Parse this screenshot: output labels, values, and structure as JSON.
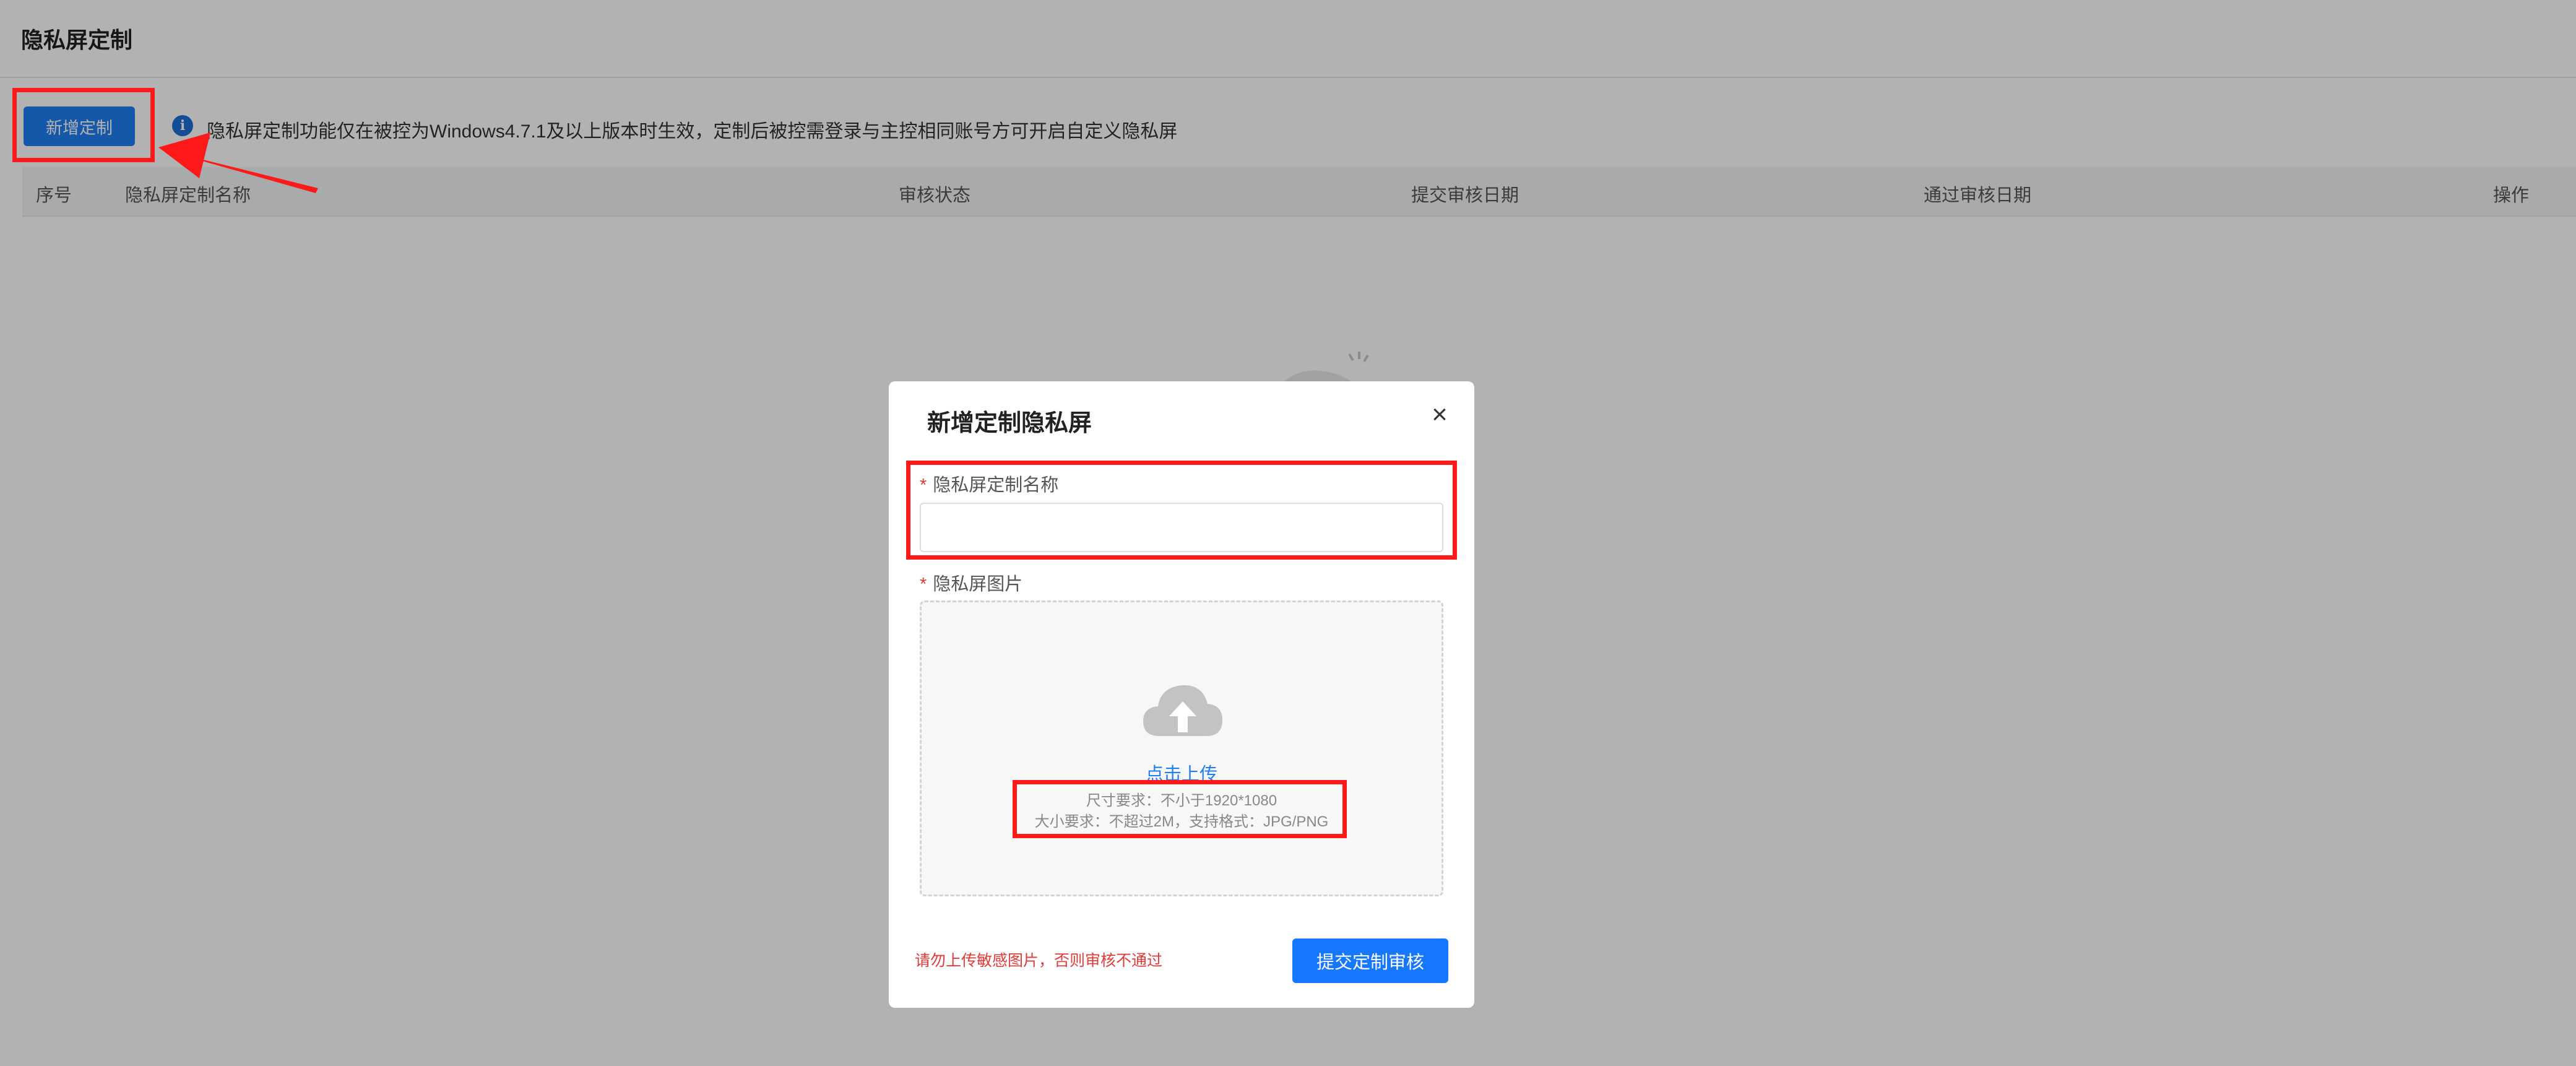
{
  "page": {
    "title": "隐私屏定制",
    "add_button": "新增定制",
    "info_text": "隐私屏定制功能仅在被控为Windows4.7.1及以上版本时生效，定制后被控需登录与主控相同账号方可开启自定义隐私屏",
    "info_icon": "info-icon"
  },
  "table": {
    "columns": [
      "序号",
      "隐私屏定制名称",
      "审核状态",
      "提交审核日期",
      "通过审核日期",
      "操作"
    ]
  },
  "modal": {
    "title": "新增定制隐私屏",
    "close_icon": "close-icon",
    "required_mark": "*",
    "name_label": "隐私屏定制名称",
    "name_value": "",
    "image_label": "隐私屏图片",
    "upload": {
      "icon": "cloud-upload-icon",
      "link": "点击上传",
      "size_hint": "尺寸要求：不小于1920*1080",
      "format_hint": "大小要求：不超过2M，支持格式：JPG/PNG"
    },
    "warning": "请勿上传敏感图片，否则审核不通过",
    "submit_button": "提交定制审核"
  },
  "colors": {
    "primary": "#1677ff",
    "annotation_red": "#ff1a1a",
    "required_red": "#e03a3a",
    "overlay": "rgba(0,0,0,0.30)"
  }
}
